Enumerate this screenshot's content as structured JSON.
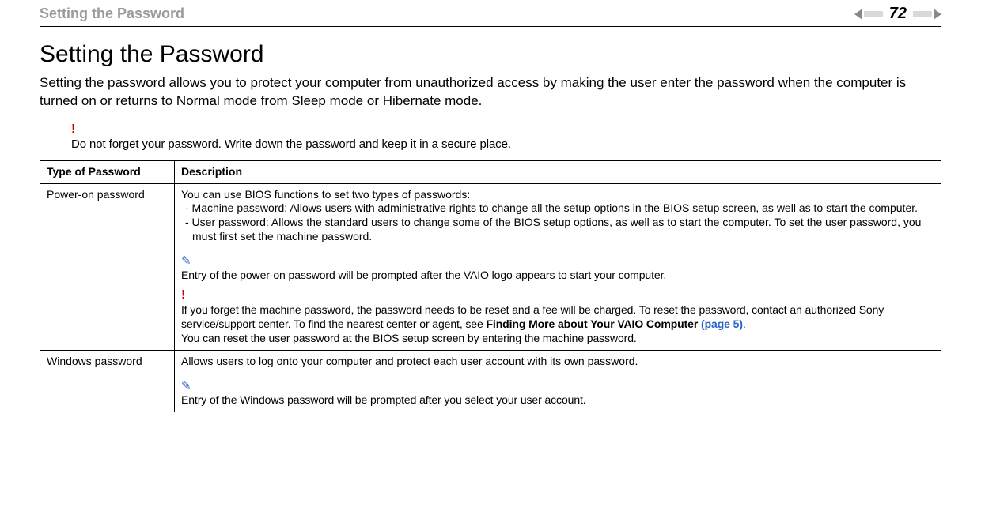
{
  "header": {
    "breadcrumb": "Setting the Password",
    "page_number": "72"
  },
  "title": "Setting the Password",
  "intro": "Setting the password allows you to protect your computer from unauthorized access by making the user enter the password when the computer is turned on or returns to Normal mode from Sleep mode or Hibernate mode.",
  "top_note": {
    "text": "Do not forget your password. Write down the password and keep it in a secure place."
  },
  "table": {
    "headers": {
      "col1": "Type of Password",
      "col2": "Description"
    },
    "rows": [
      {
        "type": "Power-on password",
        "desc_intro": "You can use BIOS functions to set two types of passwords:",
        "bullet1": "- Machine password: Allows users with administrative rights to change all the setup options in the BIOS setup screen, as well as to start the computer.",
        "bullet2": "- User password: Allows the standard users to change some of the BIOS setup options, as well as to start the computer. To set the user password, you must first set the machine password.",
        "pencil_note": "Entry of the power-on password will be prompted after the VAIO logo appears to start your computer.",
        "bang_note_pre": "If you forget the machine password, the password needs to be reset and a fee will be charged. To reset the password, contact an authorized Sony service/support center. To find the nearest center or agent, see ",
        "bang_note_bold": "Finding More about Your VAIO Computer ",
        "bang_note_link": "(page 5)",
        "bang_note_post": ".",
        "bang_note_tail": "You can reset the user password at the BIOS setup screen by entering the machine password."
      },
      {
        "type": "Windows password",
        "desc_intro": "Allows users to log onto your computer and protect each user account with its own password.",
        "pencil_note": "Entry of the Windows password will be prompted after you select your user account."
      }
    ]
  }
}
